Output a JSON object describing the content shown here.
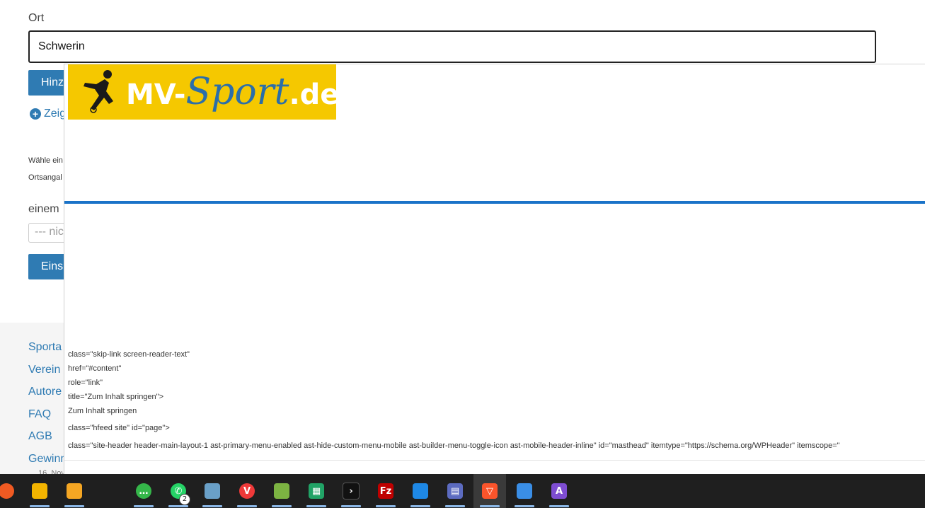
{
  "form": {
    "ort_label": "Ort",
    "ort_value": "Schwerin",
    "add_button": "Hinz",
    "show_link": "Zeig",
    "help_line1": "Wähle ein",
    "help_line2": "Ortsangal",
    "einem_label": "einem",
    "select_value": "--- nic",
    "submit_button": "Eins"
  },
  "footer": {
    "links": [
      "Sporta",
      "Verein",
      "Autore",
      "FAQ",
      "AGB",
      "Gewinn"
    ]
  },
  "overlay": {
    "logo": {
      "mv": "MV-",
      "sport": "Sport",
      "de": ".de"
    },
    "code_lines": [
      "class=\"skip-link screen-reader-text\"",
      "href=\"#content\"",
      "role=\"link\"",
      "title=\"Zum Inhalt springen\">",
      "Zum Inhalt springen",
      "class=\"hfeed site\" id=\"page\">",
      "class=\"site-header header-main-layout-1 ast-primary-menu-enabled ast-hide-custom-menu-mobile ast-builder-menu-toggle-icon ast-mobile-header-inline\" id=\"masthead\" itemtype=\"https://schema.org/WPHeader\" itemscope=\""
    ]
  },
  "taskbar": {
    "date_tooltip": "16. Nov",
    "apps": [
      {
        "icon": "app-orange-icon",
        "color": "#f05a22"
      },
      {
        "icon": "file-explorer-icon",
        "color": "#f3b400"
      },
      {
        "icon": "folder-icon",
        "color": "#f5a623"
      },
      {
        "icon": "messages-icon",
        "color": "#35b74a"
      },
      {
        "icon": "whatsapp-icon",
        "color": "#25d366",
        "badge": "2"
      },
      {
        "icon": "scanner-icon",
        "color": "#6aa0c8"
      },
      {
        "icon": "vivaldi-icon",
        "color": "#ef3939"
      },
      {
        "icon": "chart-app-icon",
        "color": "#7cb342"
      },
      {
        "icon": "spreadsheet-icon",
        "color": "#21a366"
      },
      {
        "icon": "terminal-icon",
        "color": "#111111"
      },
      {
        "icon": "filezilla-icon",
        "color": "#bf0000"
      },
      {
        "icon": "network-app-icon",
        "color": "#1e88e5"
      },
      {
        "icon": "calculator-icon",
        "color": "#5c6bc0"
      },
      {
        "icon": "brave-icon",
        "color": "#fb542b"
      },
      {
        "icon": "editor-icon",
        "color": "#3a8ee6"
      },
      {
        "icon": "affinity-icon",
        "color": "#7e4dd2"
      }
    ]
  }
}
